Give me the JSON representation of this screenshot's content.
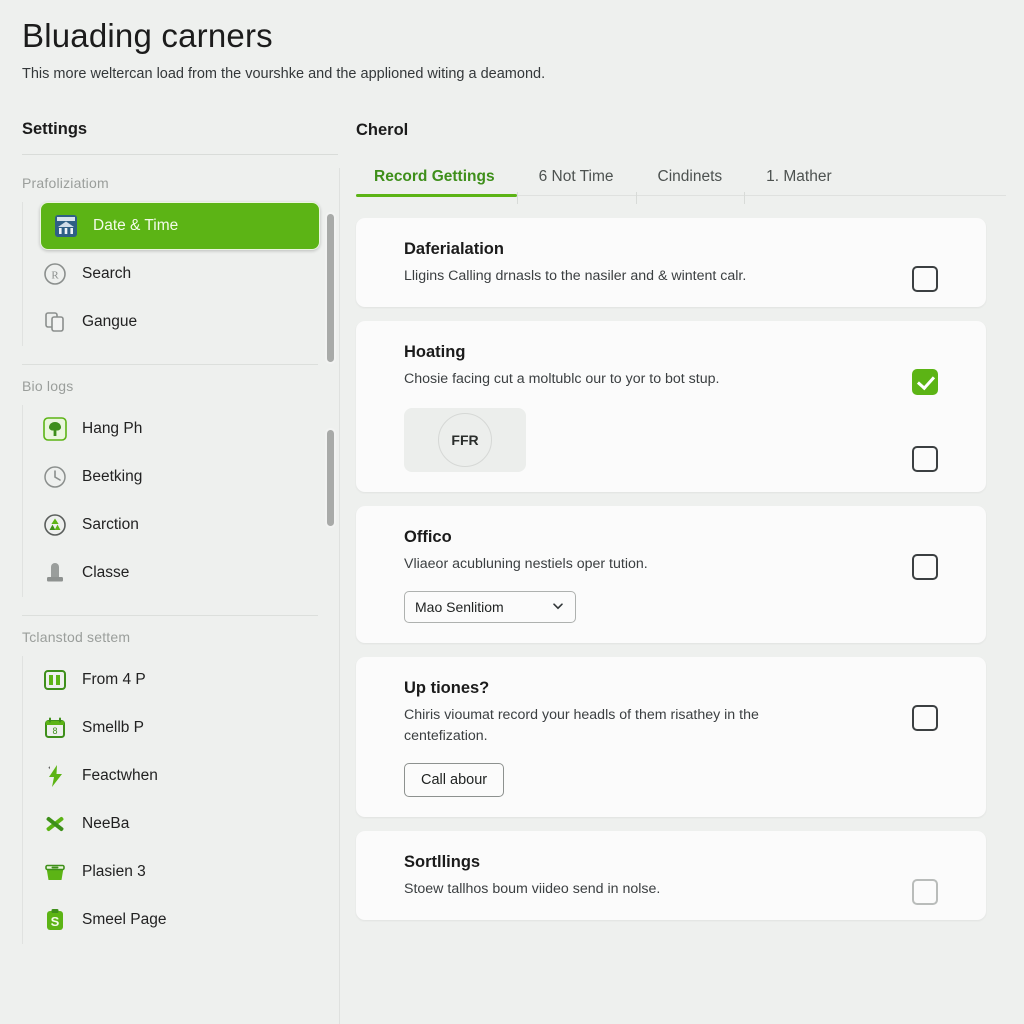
{
  "header": {
    "title": "Bluading carners",
    "subtitle": "This more weltercan load from the vourshke and the applioned witing a deamond."
  },
  "sidebar": {
    "heading": "Settings",
    "sections": [
      {
        "label": "Prafoliziatiom",
        "items": [
          {
            "label": "Date & Time",
            "icon": "bank-icon",
            "active": true
          },
          {
            "label": "Search",
            "icon": "registered-icon",
            "active": false
          },
          {
            "label": "Gangue",
            "icon": "copy-icon",
            "active": false
          }
        ]
      },
      {
        "label": "Bio logs",
        "items": [
          {
            "label": "Hang Ph",
            "icon": "tree-icon",
            "active": false
          },
          {
            "label": "Beetking",
            "icon": "clock-icon",
            "active": false
          },
          {
            "label": "Sarction",
            "icon": "recycle-icon",
            "active": false
          },
          {
            "label": "Classe",
            "icon": "bollard-icon",
            "active": false
          }
        ]
      },
      {
        "label": "Tclanstod settem",
        "items": [
          {
            "label": "From 4 P",
            "icon": "window-split-icon",
            "active": false
          },
          {
            "label": "Smellb P",
            "icon": "calendar-icon",
            "active": false
          },
          {
            "label": "Feactwhen",
            "icon": "bolt-icon",
            "active": false
          },
          {
            "label": "NeeBa",
            "icon": "tools-cross-icon",
            "active": false
          },
          {
            "label": "Plasien 3",
            "icon": "basket-icon",
            "active": false
          },
          {
            "label": "Smeel Page",
            "icon": "clipboard-dollar-icon",
            "active": false
          }
        ]
      }
    ]
  },
  "main": {
    "heading": "Cherol",
    "tabs": [
      {
        "label": "Record Gettings",
        "active": true
      },
      {
        "label": "6 Not Time",
        "active": false
      },
      {
        "label": "Cindinets",
        "active": false
      },
      {
        "label": "1. Mather",
        "active": false
      }
    ],
    "cards": [
      {
        "title": "Daferialation",
        "desc": "Lligins Calling drnasls to the nasiler and & wintent calr.",
        "checked": false,
        "control": "none"
      },
      {
        "title": "Hoating",
        "desc": "Chosie facing cut a moltublc our to yor to bot stup.",
        "checked": true,
        "control": "badge",
        "badge_label": "FFR",
        "second_checkbox": true
      },
      {
        "title": "Offico",
        "desc": "Vliaeor acubluning nestiels oper tution.",
        "checked": false,
        "control": "select",
        "select_value": "Mao Senlitiom"
      },
      {
        "title": "Up tiones?",
        "desc": "Chiris vioumat record your headls of them risathey in the centefization.",
        "checked": false,
        "control": "button",
        "button_label": "Call abour"
      },
      {
        "title": "Sortllings",
        "desc": "Stoew tallhos boum viideo send in nolse.",
        "checked": false,
        "control": "none",
        "checkbox_light": true
      }
    ]
  },
  "colors": {
    "accent_green": "#5cb415",
    "tab_green": "#3e8f1a",
    "page_bg": "#eef0ee",
    "card_bg": "#fbfbfb"
  }
}
